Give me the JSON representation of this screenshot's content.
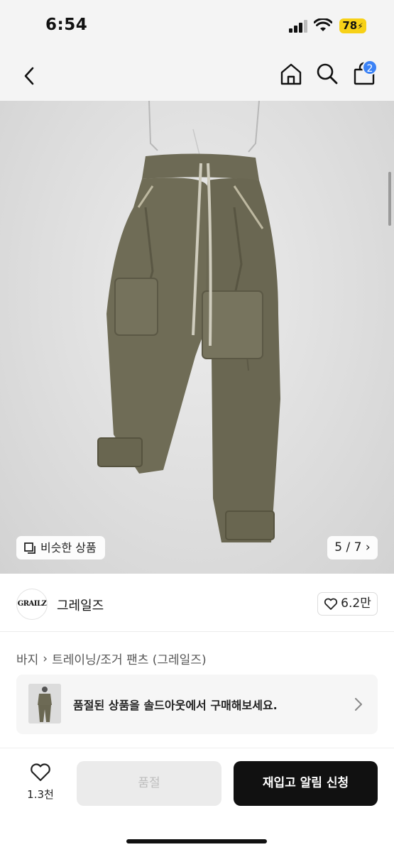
{
  "status_bar": {
    "time": "6:54",
    "battery": "78"
  },
  "nav": {
    "cart_count": "2"
  },
  "image": {
    "similar_label": "비슷한 상품",
    "counter": "5 / 7"
  },
  "brand": {
    "logo_text": "GRAILZ",
    "name": "그레일즈",
    "wish_count": "6.2만"
  },
  "breadcrumb": {
    "category": "바지",
    "subcategory": "트레이닝/조거 팬츠 (그레일즈)"
  },
  "soldout_banner": {
    "text": "품절된 상품을 솔드아웃에서 구매해보세요."
  },
  "bottom": {
    "like_count": "1.3천",
    "soldout_label": "품절",
    "restock_label": "재입고 알림 신청"
  },
  "colors": {
    "accent_blue": "#3b82f6",
    "battery_yellow": "#f7d117",
    "primary_button": "#111111"
  },
  "icons": [
    "back-icon",
    "home-icon",
    "search-icon",
    "bag-icon",
    "similar-icon",
    "heart-icon",
    "chevron-right-icon"
  ]
}
